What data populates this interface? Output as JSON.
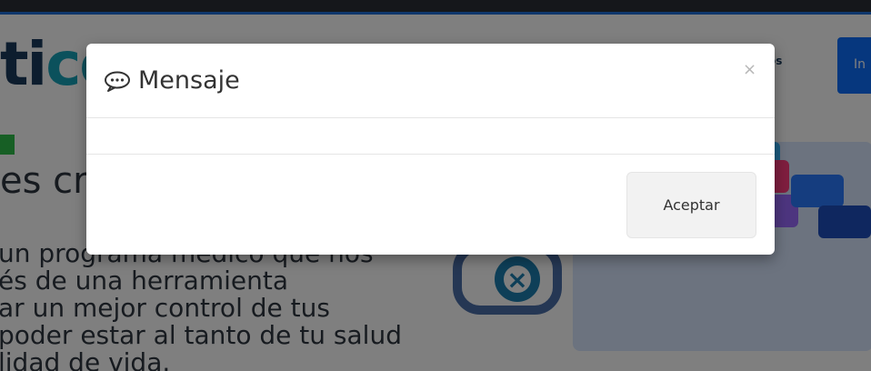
{
  "page": {
    "logo_part1": "ti",
    "logo_part2": "co",
    "nav_text": "os",
    "nav_button": "In",
    "headline": "es cr",
    "paragraph_lines": [
      "un programa médico que nos",
      "és de una herramienta",
      "ar un mejor control de tus",
      "poder estar al tanto de tu salud",
      "lidad de vida."
    ]
  },
  "modal": {
    "title": "Mensaje",
    "close_symbol": "×",
    "body_text": "",
    "accept_button": "Aceptar"
  }
}
